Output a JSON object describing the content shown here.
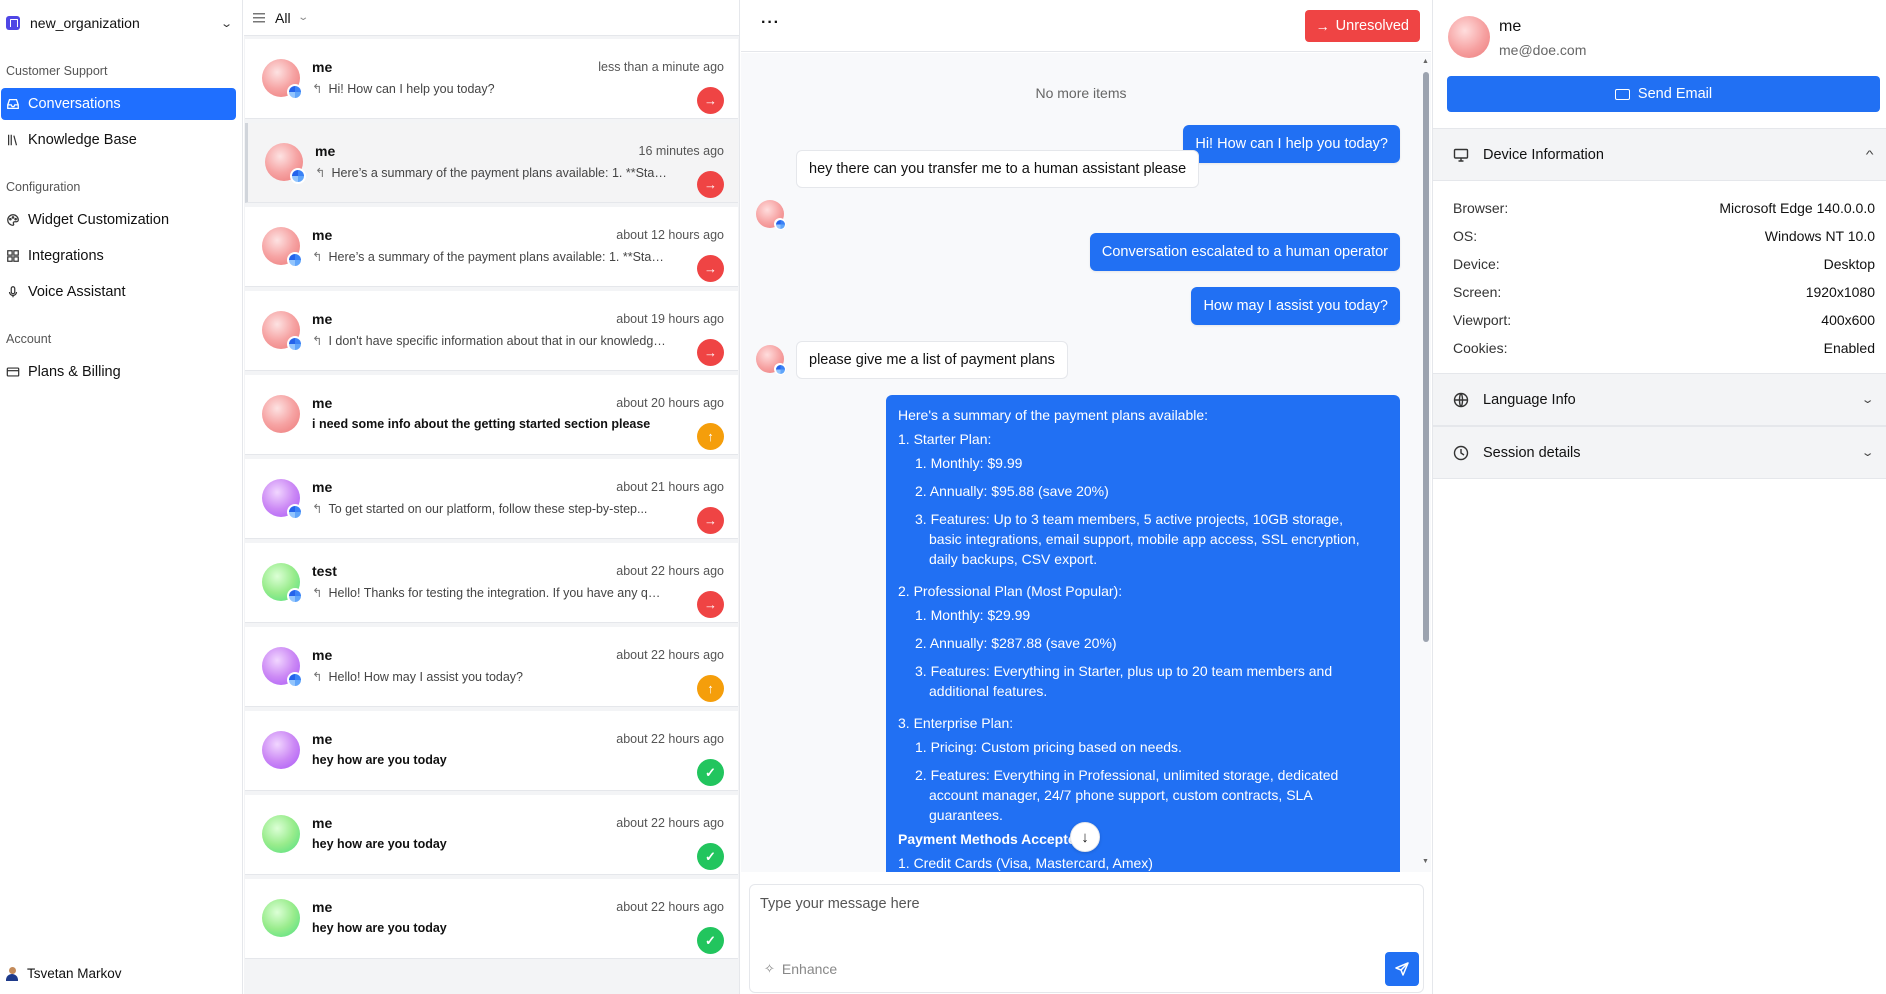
{
  "sidebar": {
    "org_name": "new_organization",
    "sections": [
      {
        "title": "Customer Support",
        "items": [
          {
            "label": "Conversations",
            "icon": "inbox-icon",
            "active": true
          },
          {
            "label": "Knowledge Base",
            "icon": "library-icon"
          }
        ]
      },
      {
        "title": "Configuration",
        "items": [
          {
            "label": "Widget Customization",
            "icon": "palette-icon"
          },
          {
            "label": "Integrations",
            "icon": "grid-icon"
          },
          {
            "label": "Voice Assistant",
            "icon": "mic-icon"
          }
        ]
      },
      {
        "title": "Account",
        "items": [
          {
            "label": "Plans & Billing",
            "icon": "credit-card-icon"
          }
        ]
      }
    ],
    "user_name": "Tsvetan Markov"
  },
  "list": {
    "filter_label": "All",
    "conversations": [
      {
        "name": "me",
        "time": "less than a minute ago",
        "preview": "Hi! How can I help you today?",
        "reply": true,
        "status": "red",
        "avatar": "pink"
      },
      {
        "name": "me",
        "time": "16 minutes ago",
        "preview": "Here’s a summary of the payment plans available: 1. **Starter...",
        "reply": true,
        "status": "red",
        "avatar": "pink"
      },
      {
        "name": "me",
        "time": "about 12 hours ago",
        "preview": "Here’s a summary of the payment plans available: 1. **Starter...",
        "reply": true,
        "status": "red",
        "avatar": "pink"
      },
      {
        "name": "me",
        "time": "about 19 hours ago",
        "preview": "I don't have specific information about that in our knowledge...",
        "reply": true,
        "status": "red",
        "avatar": "pink"
      },
      {
        "name": "me",
        "time": "about 20 hours ago",
        "preview": "i need some info about the getting started section please",
        "reply": false,
        "status": "amber",
        "avatar": "pink"
      },
      {
        "name": "me",
        "time": "about 21 hours ago",
        "preview": "To get started on our platform, follow these step-by-step...",
        "reply": true,
        "status": "red",
        "avatar": "purple"
      },
      {
        "name": "test",
        "time": "about 22 hours ago",
        "preview": "Hello! Thanks for testing the integration. If you have any questio...",
        "reply": true,
        "status": "red",
        "avatar": "green"
      },
      {
        "name": "me",
        "time": "about 22 hours ago",
        "preview": "Hello! How may I assist you today?",
        "reply": true,
        "status": "amber",
        "avatar": "purple"
      },
      {
        "name": "me",
        "time": "about 22 hours ago",
        "preview": "hey how are you today",
        "reply": false,
        "status": "green",
        "avatar": "purple"
      },
      {
        "name": "me",
        "time": "about 22 hours ago",
        "preview": "hey how are you today",
        "reply": false,
        "status": "green",
        "avatar": "green"
      },
      {
        "name": "me",
        "time": "about 22 hours ago",
        "preview": "hey how are you today",
        "reply": false,
        "status": "green",
        "avatar": "green"
      }
    ]
  },
  "chat": {
    "status_label": "Unresolved",
    "no_more": "No more items",
    "messages": [
      {
        "from": "agent",
        "text": "Hi! How can I help you today?"
      },
      {
        "from": "user",
        "text": "hey there can you transfer me to a human assistant please"
      },
      {
        "from": "agent",
        "text": "Conversation escalated to a human operator"
      },
      {
        "from": "agent",
        "text": "How may I assist you today?"
      },
      {
        "from": "user",
        "text": "please give me a list of payment plans"
      }
    ],
    "summary": {
      "intro": "Here's a summary of the payment plans available:",
      "starter": "1. Starter Plan:",
      "s1a": "1. Monthly:",
      "s1b": " $9.99",
      "s2a": "2. Annually:",
      "s2b": " $95.88 (save 20%)",
      "s3a": "3. Features:",
      "s3b": " Up to 3 team members, 5 active projects, 10GB storage,",
      "s3c": "basic integrations, email support, mobile app access, SSL encryption,",
      "s3d": "daily backups, CSV export.",
      "pro": "2. Professional Plan (Most Popular):",
      "p1a": "1. Monthly:",
      "p1b": " $29.99",
      "p2a": "2. Annually:",
      "p2b": " $287.88 (save 20%)",
      "p3a": "3. Features:",
      "p3b": " Everything in Starter, plus up to 20 team members and",
      "p3c": "additional features.",
      "ent": "3. Enterprise Plan:",
      "e1a": "1. Pricing:",
      "e1b": " Custom pricing based on needs.",
      "e2a": "2. Features:",
      "e2b": " Everything in Professional, unlimited storage, dedicated",
      "e2c": "account manager, 24/7 phone support, custom contracts, SLA",
      "e2d": "guarantees.",
      "pm": "Payment Methods Accepted:",
      "pm1": "1. Credit Cards (Visa, Mastercard, Amex)"
    },
    "input_placeholder": "Type your message here",
    "enhance_label": "Enhance"
  },
  "contact": {
    "name": "me",
    "email": "me@doe.com",
    "send_email_label": "Send Email",
    "device_title": "Device Information",
    "device": [
      {
        "k": "Browser:",
        "v": "Microsoft Edge 140.0.0.0"
      },
      {
        "k": "OS:",
        "v": "Windows NT 10.0"
      },
      {
        "k": "Device:",
        "v": "Desktop"
      },
      {
        "k": "Screen:",
        "v": "1920x1080"
      },
      {
        "k": "Viewport:",
        "v": "400x600"
      },
      {
        "k": "Cookies:",
        "v": "Enabled"
      }
    ],
    "language_title": "Language Info",
    "session_title": "Session details"
  },
  "colors": {
    "primary": "#2170f3",
    "danger": "#ef4444",
    "warning": "#f59e0b",
    "success": "#22c55e"
  }
}
